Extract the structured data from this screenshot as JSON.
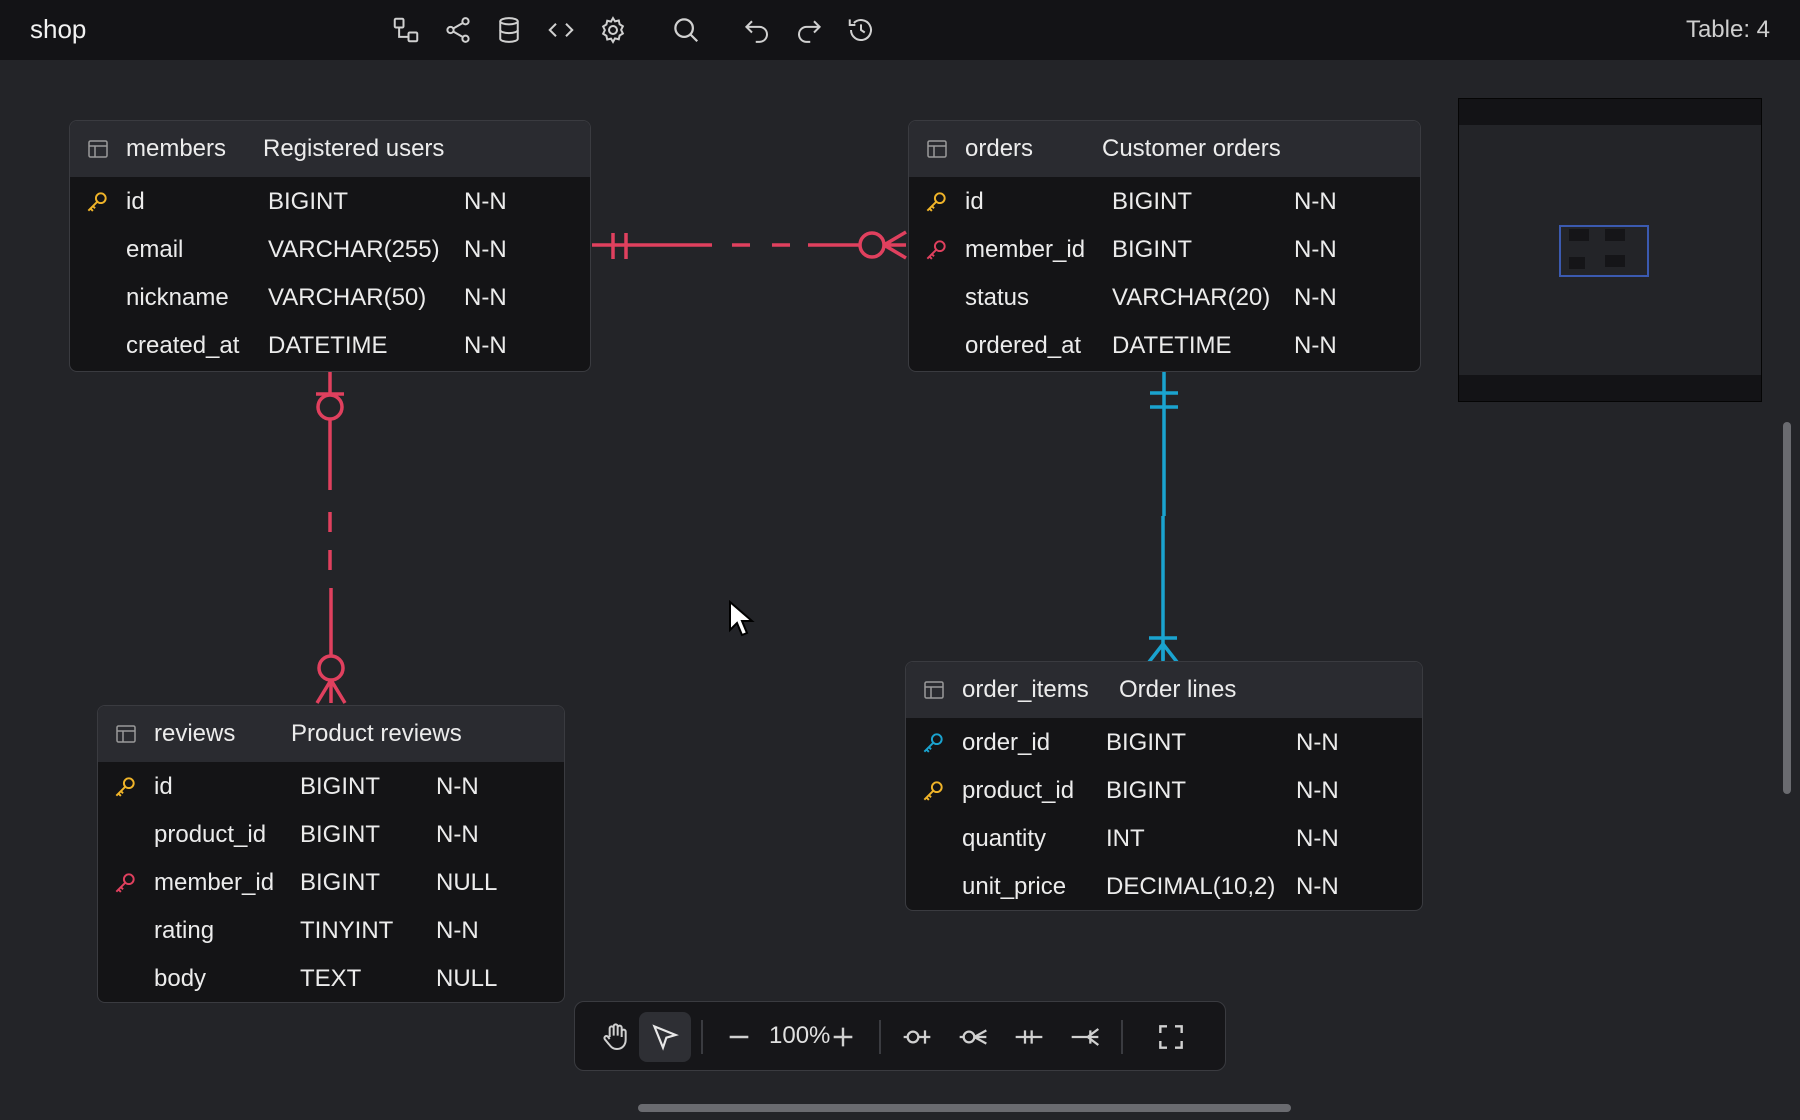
{
  "app": {
    "title": "shop",
    "table_count": "Table: 4"
  },
  "toolbar_icons": [
    "diagram-icon",
    "share-icon",
    "database-icon",
    "code-icon",
    "settings-icon",
    "search-icon",
    "undo-icon",
    "redo-icon",
    "history-icon"
  ],
  "tables": {
    "members": {
      "name": "members",
      "comment": "Registered users",
      "columns": [
        {
          "name": "id",
          "type": "BIGINT",
          "nullable": "N-N",
          "key": "primary"
        },
        {
          "name": "email",
          "type": "VARCHAR(255)",
          "nullable": "N-N",
          "key": ""
        },
        {
          "name": "nickname",
          "type": "VARCHAR(50)",
          "nullable": "N-N",
          "key": ""
        },
        {
          "name": "created_at",
          "type": "DATETIME",
          "nullable": "N-N",
          "key": ""
        }
      ]
    },
    "orders": {
      "name": "orders",
      "comment": "Customer orders",
      "columns": [
        {
          "name": "id",
          "type": "BIGINT",
          "nullable": "N-N",
          "key": "primary"
        },
        {
          "name": "member_id",
          "type": "BIGINT",
          "nullable": "N-N",
          "key": "foreign"
        },
        {
          "name": "status",
          "type": "VARCHAR(20)",
          "nullable": "N-N",
          "key": ""
        },
        {
          "name": "ordered_at",
          "type": "DATETIME",
          "nullable": "N-N",
          "key": ""
        }
      ]
    },
    "reviews": {
      "name": "reviews",
      "comment": "Product reviews",
      "columns": [
        {
          "name": "id",
          "type": "BIGINT",
          "nullable": "N-N",
          "key": "primary"
        },
        {
          "name": "product_id",
          "type": "BIGINT",
          "nullable": "N-N",
          "key": ""
        },
        {
          "name": "member_id",
          "type": "BIGINT",
          "nullable": "NULL",
          "key": "foreign"
        },
        {
          "name": "rating",
          "type": "TINYINT",
          "nullable": "N-N",
          "key": ""
        },
        {
          "name": "body",
          "type": "TEXT",
          "nullable": "NULL",
          "key": ""
        }
      ]
    },
    "order_items": {
      "name": "order_items",
      "comment": "Order lines",
      "columns": [
        {
          "name": "order_id",
          "type": "BIGINT",
          "nullable": "N-N",
          "key": "primary-foreign"
        },
        {
          "name": "product_id",
          "type": "BIGINT",
          "nullable": "N-N",
          "key": "primary"
        },
        {
          "name": "quantity",
          "type": "INT",
          "nullable": "N-N",
          "key": ""
        },
        {
          "name": "unit_price",
          "type": "DECIMAL(10,2)",
          "nullable": "N-N",
          "key": ""
        }
      ]
    }
  },
  "relationships": [
    {
      "from": "members",
      "to": "orders",
      "cardinality": "one-only to zero-or-many",
      "style": "dashed",
      "color": "#e0405e"
    },
    {
      "from": "members",
      "to": "reviews",
      "cardinality": "zero-or-one to zero-or-many",
      "style": "dashed",
      "color": "#e0405e"
    },
    {
      "from": "orders",
      "to": "order_items",
      "cardinality": "one-only to one-or-many",
      "style": "solid",
      "color": "#1aa3cf"
    }
  ],
  "colors": {
    "primary_key": "#f0b429",
    "foreign_key": "#e0405e",
    "identifying_key": "#1aa3cf",
    "minimap_viewport": "#3b5ab0"
  },
  "bottom_toolbar": {
    "zoom": "100%",
    "tools": [
      "hand-tool-icon",
      "pointer-tool-icon",
      "zoom-out-icon",
      "zoom-in-icon",
      "zero-or-one-icon",
      "zero-or-many-icon",
      "one-only-icon",
      "one-or-many-icon",
      "fullscreen-icon"
    ],
    "active_tool": "pointer-tool-icon"
  }
}
